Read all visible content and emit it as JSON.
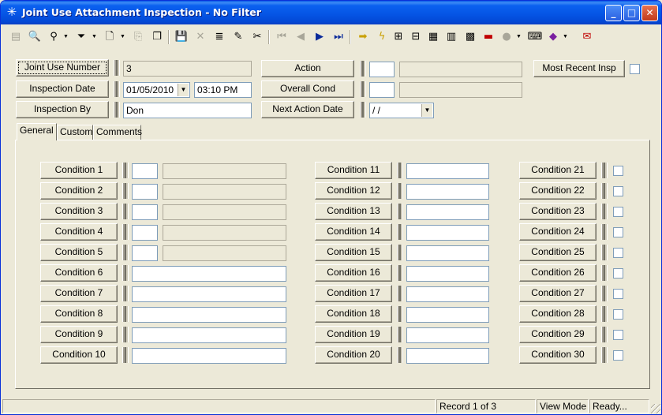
{
  "window": {
    "title": "Joint Use Attachment Inspection - No Filter",
    "controls": {
      "minimize": "_",
      "maximize": "□",
      "close": "✕"
    }
  },
  "toolbar": {
    "icons": [
      "record-icon",
      "preview-icon",
      "search-binoculars-icon",
      "filter-icon",
      "new-document-icon",
      "copy-icon",
      "duplicate-icon",
      "save-icon",
      "delete-icon",
      "stack-icon",
      "edit-pencil-icon",
      "cut-icon",
      "first-record-icon",
      "previous-record-icon",
      "next-record-icon",
      "last-record-icon",
      "jump-arrow-icon",
      "lightning-icon",
      "query-icon",
      "tree-icon",
      "map-icon",
      "calculator-icon",
      "map-grid-icon",
      "truck-icon",
      "globe-icon",
      "keyboard-icon",
      "book-icon",
      "exit-icon"
    ]
  },
  "header": {
    "joint_use_number": {
      "label": "Joint Use Number",
      "value": "3"
    },
    "inspection_date": {
      "label": "Inspection Date",
      "date": "01/05/2010",
      "time": "03:10 PM"
    },
    "inspection_by": {
      "label": "Inspection By",
      "value": "Don"
    },
    "action": {
      "label": "Action",
      "code": "",
      "desc": ""
    },
    "overall_cond": {
      "label": "Overall Cond",
      "code": "",
      "desc": ""
    },
    "next_action_date": {
      "label": "Next Action Date",
      "value": " / /"
    },
    "most_recent": {
      "label": "Most Recent Insp",
      "checked": false
    }
  },
  "tabs": [
    "General",
    "Custom",
    "Comments"
  ],
  "conditions": {
    "col1": [
      "Condition 1",
      "Condition 2",
      "Condition 3",
      "Condition 4",
      "Condition 5",
      "Condition 6",
      "Condition 7",
      "Condition 8",
      "Condition 9",
      "Condition 10"
    ],
    "col2": [
      "Condition 11",
      "Condition 12",
      "Condition 13",
      "Condition 14",
      "Condition 15",
      "Condition 16",
      "Condition 17",
      "Condition 18",
      "Condition 19",
      "Condition 20"
    ],
    "col3": [
      "Condition 21",
      "Condition 22",
      "Condition 23",
      "Condition 24",
      "Condition 25",
      "Condition 26",
      "Condition 27",
      "Condition 28",
      "Condition 29",
      "Condition 30"
    ]
  },
  "status": {
    "record": "Record 1 of 3",
    "mode": "View Mode",
    "state": "Ready..."
  }
}
